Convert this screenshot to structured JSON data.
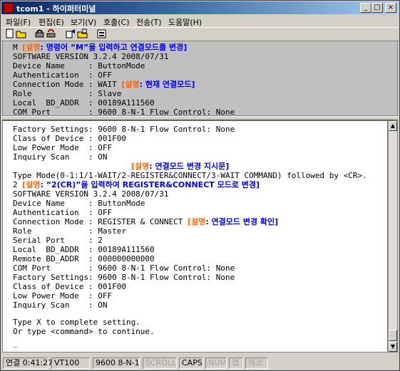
{
  "window": {
    "title": "tcom1 - 하이퍼터미널",
    "controls": {
      "minimize": "_",
      "maximize": "□",
      "close": "×"
    }
  },
  "menu": [
    "파일(F)",
    "편집(E)",
    "보기(V)",
    "호출(C)",
    "전송(T)",
    "도움말(H)"
  ],
  "toolbar": [
    "new-icon",
    "open-icon",
    "connect-icon",
    "disconnect-icon",
    "send-icon",
    "receive-icon",
    "properties-icon"
  ],
  "upper": {
    "line1": {
      "text": "M ",
      "note_label": "[설명",
      "note_text": ": 명령어 “M”을 입력하고 연결모드를 변경]"
    },
    "line2": "SOFTWARE VERSION 3.2.4 2008/07/31",
    "line3": "Device Name     : ButtonMode",
    "line4": "Authentication  : OFF",
    "line5": {
      "text": "Connection Mode : WAIT ",
      "note_label": "[설명",
      "note_text": ": 현재 연결모드]"
    },
    "line6": "Role            : Slave",
    "line7": "Local  BD_ADDR  : 00189A111560",
    "line8": "COM Port        : 9600 8-N-1 Flow Control: None"
  },
  "lower": {
    "l1": "Factory Settings: 9600 8-N-1 Flow Control: None",
    "l2": "Class of Device : 001F00",
    "l3": "Low Power Mode  : OFF",
    "l4": "Inquiry Scan    : ON",
    "l5": {
      "note_label": "[설명",
      "note_text": ": 연결모드 변경 지시문]"
    },
    "l6": "Type Mode(0-1:1/1-WAIT/2-REGISTER&CONNECT/3-WAIT COMMAND) followed by <CR>.",
    "l7": {
      "text": "2 ",
      "note_label": "[설명",
      "note_text": ": “2(CR)”을 입력하여 REGISTER&CONNECT 모드로 변경]"
    },
    "l8": "SOFTWARE VERSION 3.2.4 2008/07/31",
    "l9": "Device Name     : ButtonMode",
    "l10": "Authentication  : OFF",
    "l11": {
      "text": "Connection Mode : REGISTER & CONNECT ",
      "note_label": "[설명",
      "note_text": ": 연결모드 변경 확인]"
    },
    "l12": "Role            : Master",
    "l13": "Serial Port     : 2",
    "l14": "Local  BD_ADDR  : 00189A111560",
    "l15": "Remote BD_ADDR  : 000000000000",
    "l16": "COM Port        : 9600 8-N-1 Flow Control: None",
    "l17": "Factory Settings: 9600 8-N-1 Flow Control: None",
    "l18": "Class of Device : 001F00",
    "l19": "Low Power Mode  : OFF",
    "l20": "Inquiry Scan    : ON",
    "l21": "Type X to complete setting.",
    "l22": "Or type <command> to continue.",
    "cursor": "_"
  },
  "status": {
    "connected": "연결 0:41:27",
    "emulation": "VT100",
    "settings": "9600 8-N-1",
    "scroll": "SCROLL",
    "caps": "CAPS",
    "num": "NUM",
    "capture": "캡",
    "echo": "에코"
  },
  "colors": {
    "note_label": "#ff6600",
    "note_text": "#0000ff",
    "titlebar": "#0a246a"
  }
}
